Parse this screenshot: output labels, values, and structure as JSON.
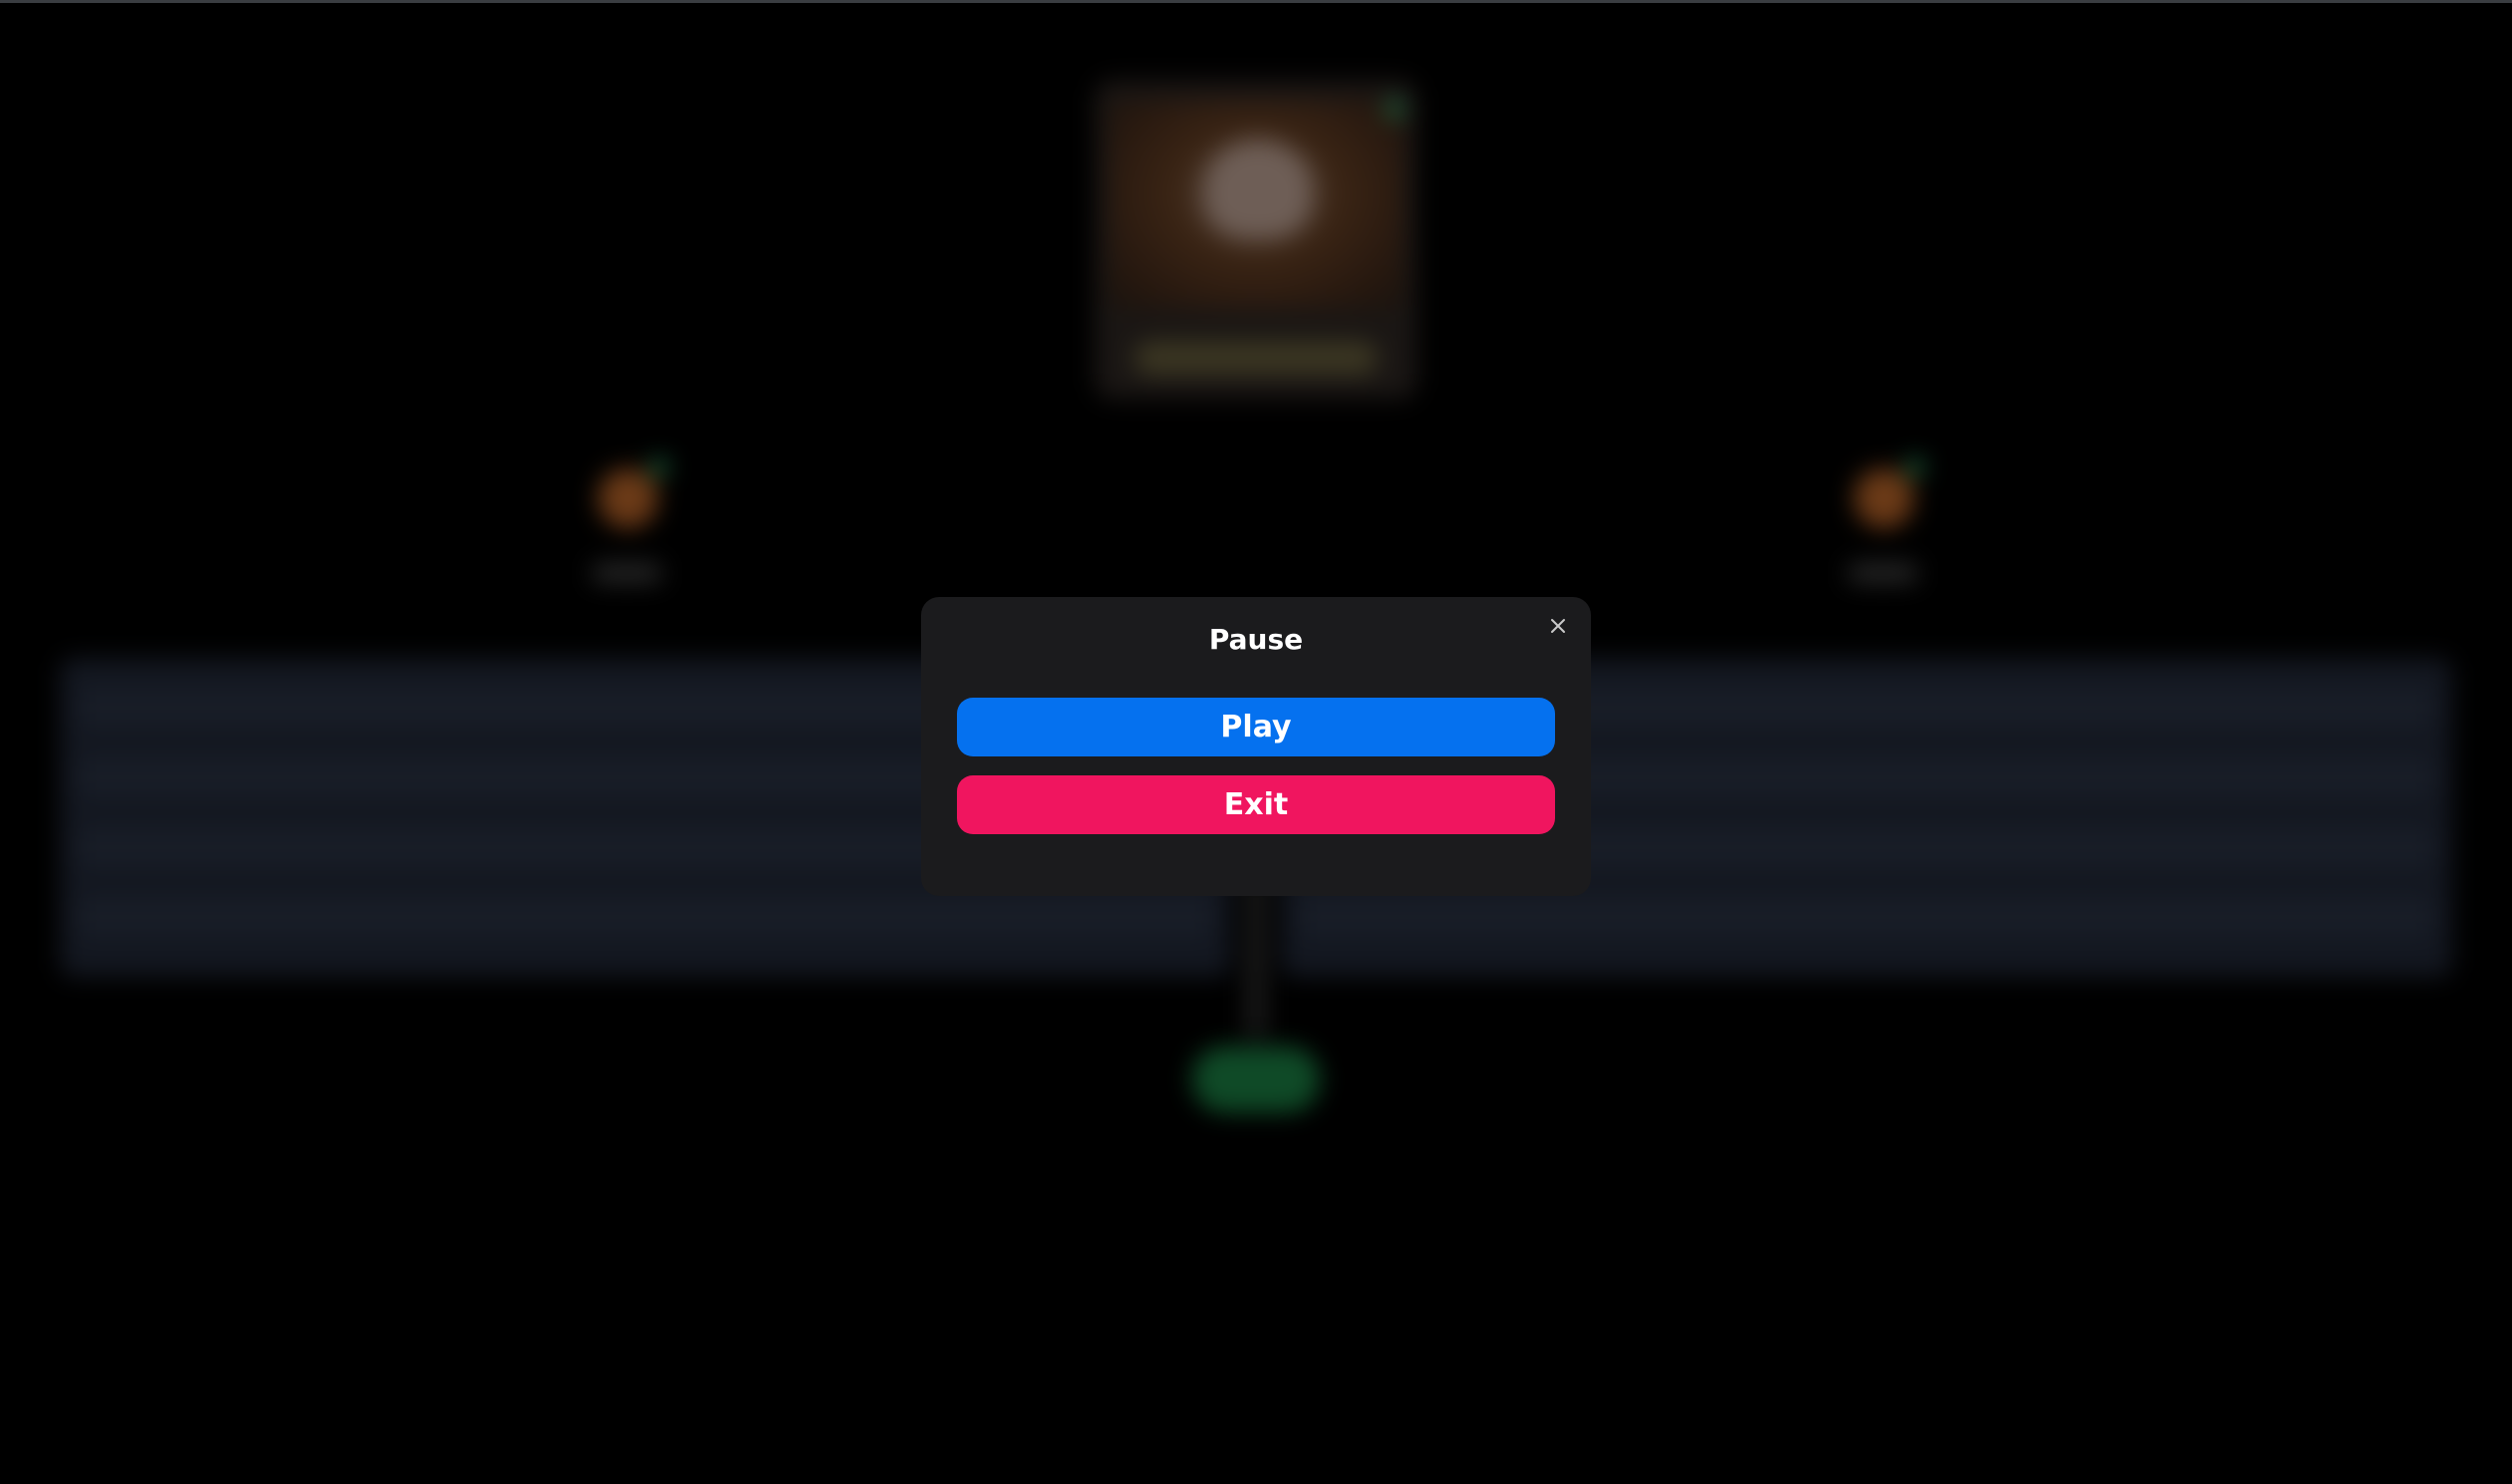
{
  "modal": {
    "title": "Pause",
    "close_icon": "close-icon",
    "play_label": "Play",
    "exit_label": "Exit"
  },
  "colors": {
    "background": "#000000",
    "modal_background": "#1b1b1d",
    "play_button": "#0571ef",
    "exit_button": "#f0155f",
    "text": "#ffffff"
  }
}
